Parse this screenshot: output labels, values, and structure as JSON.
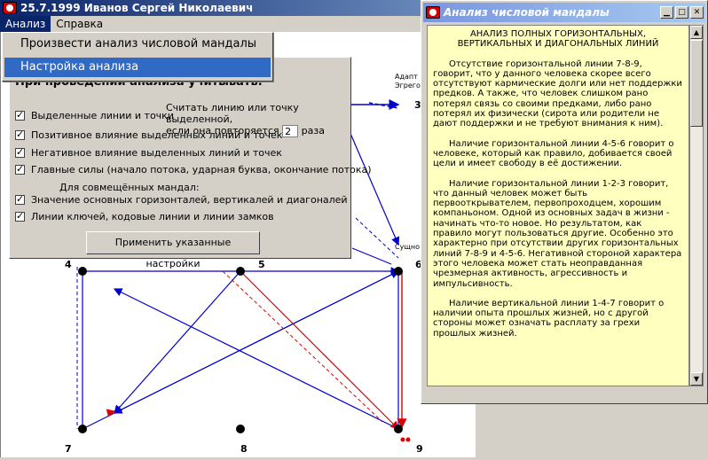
{
  "app": {
    "title": "25.7.1999  Иванов Сергей Николаевич"
  },
  "menu": {
    "analysis": "Анализ",
    "help": "Справка"
  },
  "dropdown": {
    "run_analysis": "Произвести анализ числовой мандалы",
    "settings": "Настройка анализа"
  },
  "settings": {
    "header": "При проведении анализа учитывать:",
    "repeat_text_1": "Считать линию или точку выделенной,",
    "repeat_text_2": "если она повторяется",
    "repeat_value": "2",
    "repeat_suffix": "раза",
    "checkboxes": [
      "Выделенные линии и точки",
      "Позитивное влияние выделенных линий и точек",
      "Негативное влияние выделенных линий и точек",
      "Главные силы (начало потока, ударная буква, окончание потока)",
      "Значение основных горизонталей, вертикалей и диагоналей",
      "Линии ключей, кодовые линии и линии замков"
    ],
    "subheader": "Для совмещённых мандал:",
    "apply_label": "Применить указанные настройки"
  },
  "mandala": {
    "node_labels": [
      "4",
      "5",
      "6",
      "7",
      "8",
      "9",
      "3"
    ],
    "partial_1": "Адапт",
    "partial_2": "Эгрего",
    "partial_3": "Сущно"
  },
  "text_window": {
    "title": "Анализ числовой мандалы",
    "heading": "АНАЛИЗ ПОЛНЫХ ГОРИЗОНТАЛЬНЫХ, ВЕРТИКАЛЬНЫХ И ДИАГОНАЛЬНЫХ ЛИНИЙ",
    "paragraphs": [
      "Отсутствие горизонтальной линии 7-8-9, говорит, что у данного человека скорее всего отсутствуют кармические долги или нет поддержки предков. А также, что человек слишком рано потерял связь со своими предками, либо рано потерял их физически (сирота или родители не дают поддержки и не требуют внимания к ним).",
      "Наличие горизонтальной линии 4-5-6 говорит о человеке, который как правило, добивается своей цели и имеет свободу в её достижении.",
      "Наличие горизонтальной линии 1-2-3 говорит, что данный человек может быть первооткрывателем, первопроходцем, хорошим компаньоном. Одной из основных задач в жизни - начинать что-то новое. Но результатом, как правило могут пользоваться другие. Особенно это характерно при отсутствии других горизонтальных линий 7-8-9 и 4-5-6. Негативной стороной характера этого человека может стать неоправданная чрезмерная активность, агрессивность и импульсивность.",
      "Наличие вертикальной линии 1-4-7 говорит о наличии опыта прошлых жизней, но с другой стороны может означать расплату за грехи прошлых жизней."
    ]
  },
  "colors": {
    "line_blue": "#0000cc",
    "line_red": "#dd0000",
    "doc_bg": "#ffffc0",
    "titlebar": "#0a246a"
  }
}
